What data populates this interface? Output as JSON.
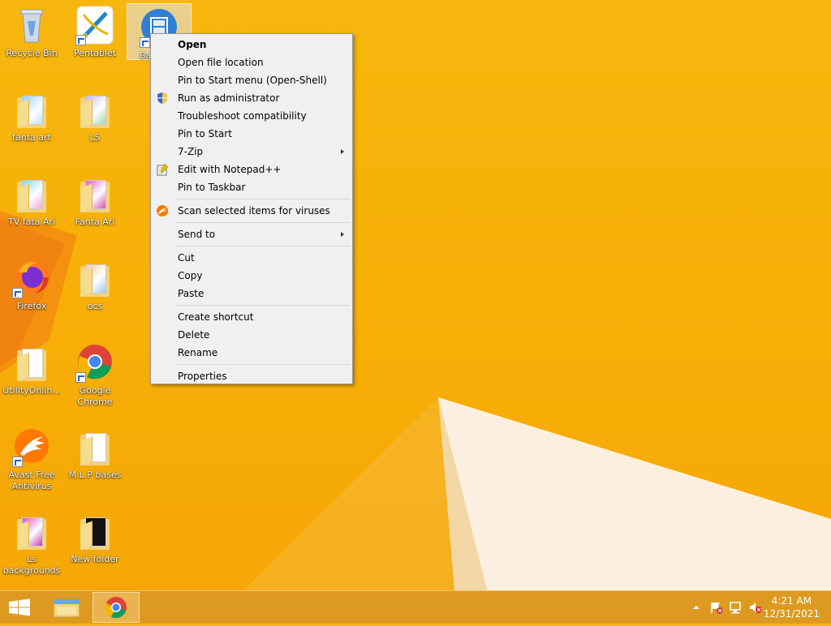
{
  "desktop": {
    "icons": [
      {
        "label": "Recycle Bin"
      },
      {
        "label": "Pentablet"
      },
      {
        "label": "Ba"
      },
      {
        "label": "fanta art"
      },
      {
        "label": "LS"
      },
      {
        "label": "TV fata Ari"
      },
      {
        "label": "Fanta Ari"
      },
      {
        "label": "Firefox"
      },
      {
        "label": "ocs"
      },
      {
        "label": "UtilityOnlin..."
      },
      {
        "label": "Google Chrome"
      },
      {
        "label": "Avast Free Antivirus"
      },
      {
        "label": "M.L.P bases"
      },
      {
        "label": "Ls backgrounds"
      },
      {
        "label": "New folder"
      }
    ]
  },
  "context_menu": {
    "items": [
      {
        "label": "Open"
      },
      {
        "label": "Open file location"
      },
      {
        "label": "Pin to Start menu (Open-Shell)"
      },
      {
        "label": "Run as administrator"
      },
      {
        "label": "Troubleshoot compatibility"
      },
      {
        "label": "Pin to Start"
      },
      {
        "label": "7-Zip"
      },
      {
        "label": "Edit with Notepad++"
      },
      {
        "label": "Pin to Taskbar"
      },
      {
        "label": "Scan selected items for viruses"
      },
      {
        "label": "Send to"
      },
      {
        "label": "Cut"
      },
      {
        "label": "Copy"
      },
      {
        "label": "Paste"
      },
      {
        "label": "Create shortcut"
      },
      {
        "label": "Delete"
      },
      {
        "label": "Rename"
      },
      {
        "label": "Properties"
      }
    ]
  },
  "taskbar": {
    "clock": {
      "time": "4:21 AM",
      "date": "12/31/2021"
    }
  },
  "colors": {
    "wallpaper": "#f7b00a",
    "menu_bg": "#f0f0f0",
    "accent_blue": "#1e64c8"
  }
}
